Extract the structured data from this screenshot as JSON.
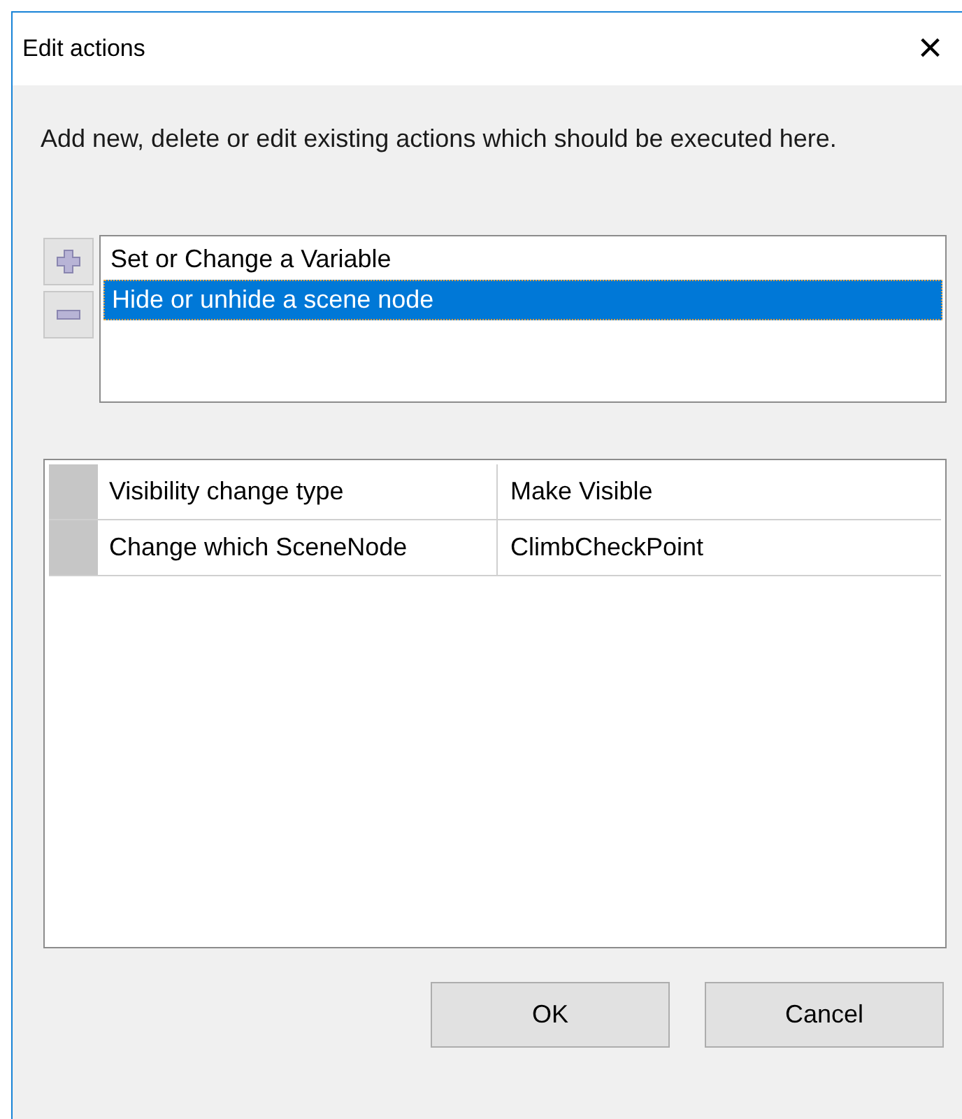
{
  "window": {
    "title": "Edit actions",
    "close": "×"
  },
  "description": "Add new, delete or edit existing actions which should be executed here.",
  "actions": [
    {
      "label": "Set or Change a Variable",
      "selected": false
    },
    {
      "label": "Hide or unhide a scene node",
      "selected": true
    }
  ],
  "properties": [
    {
      "name": "Visibility change type",
      "value": "Make Visible"
    },
    {
      "name": "Change which SceneNode",
      "value": "ClimbCheckPoint"
    }
  ],
  "buttons": [
    "OK",
    "Cancel"
  ]
}
